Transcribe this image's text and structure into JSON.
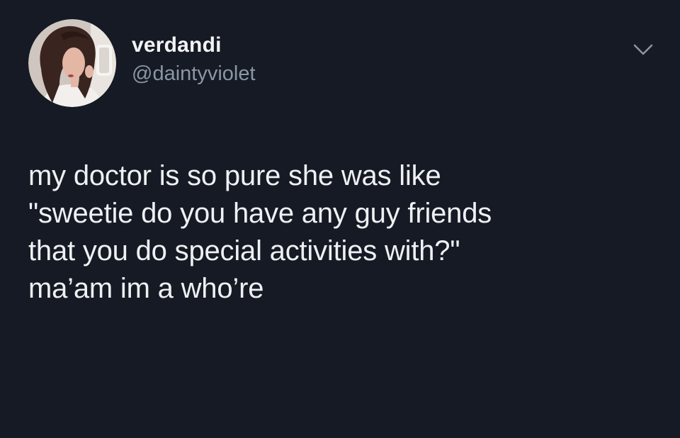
{
  "tweet": {
    "author": {
      "display_name": "verdandi",
      "handle": "@daintyviolet",
      "avatar_icon": "profile-photo"
    },
    "menu_icon": "chevron-down-icon",
    "text_lines": [
      "my doctor is so pure she was like",
      "\"sweetie do you have any guy friends",
      "that you do special activities with?\"",
      "ma’am im a who’re"
    ]
  },
  "colors": {
    "background": "#151a24",
    "primary_text": "#eef0f3",
    "secondary_text": "#8b96a5"
  }
}
